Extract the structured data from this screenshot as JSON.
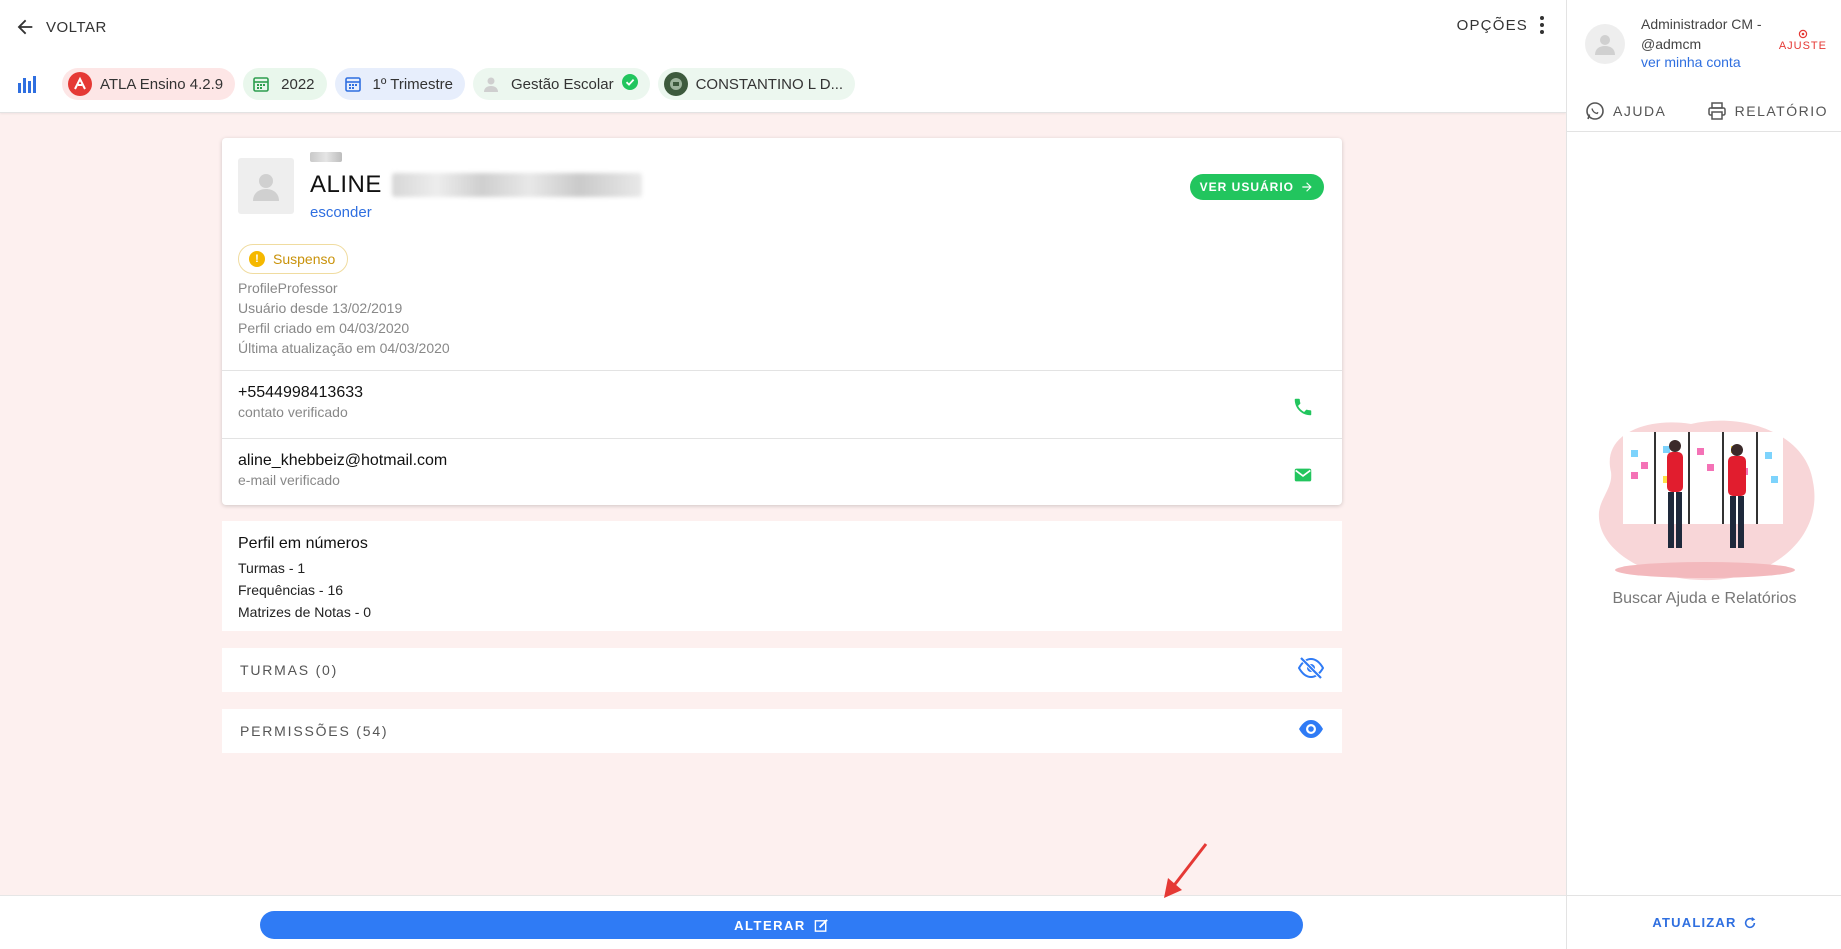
{
  "header": {
    "back_label": "VOLTAR",
    "options_label": "OPÇÕES",
    "chips": {
      "atla": "ATLA Ensino 4.2.9",
      "year": "2022",
      "trimester": "1º Trimestre",
      "gestao": "Gestão Escolar",
      "school": "CONSTANTINO L D..."
    }
  },
  "sidebar": {
    "account_name": "Administrador CM - @admcm",
    "account_link": "ver minha conta",
    "ajuste_label": "AJUSTE",
    "help_label": "AJUDA",
    "report_label": "RELATÓRIO",
    "caption": "Buscar Ajuda e Relatórios",
    "refresh_label": "ATUALIZAR"
  },
  "profile": {
    "first_name": "ALINE",
    "hide_label": "esconder",
    "view_user_label": "VER USUÁRIO",
    "status": "Suspenso",
    "meta": [
      "ProfileProfessor",
      "Usuário desde 13/02/2019",
      "Perfil criado em 04/03/2020",
      "Última atualização em 04/03/2020"
    ],
    "phone": "+5544998413633",
    "phone_status": "contato verificado",
    "email": "aline_khebbeiz@hotmail.com",
    "email_status": "e-mail verificado"
  },
  "numbers": {
    "title": "Perfil em números",
    "items": [
      "Turmas - 1",
      "Frequências - 16",
      "Matrizes de Notas - 0"
    ]
  },
  "sections": {
    "turmas": "TURMAS (0)",
    "permissoes": "PERMISSÕES (54)"
  },
  "footer": {
    "alter_label": "ALTERAR"
  },
  "colors": {
    "primary": "#2f7bf5",
    "success": "#22c55e",
    "warning": "#f5b800",
    "danger": "#e53935",
    "page_bg": "#fdf0ef"
  }
}
